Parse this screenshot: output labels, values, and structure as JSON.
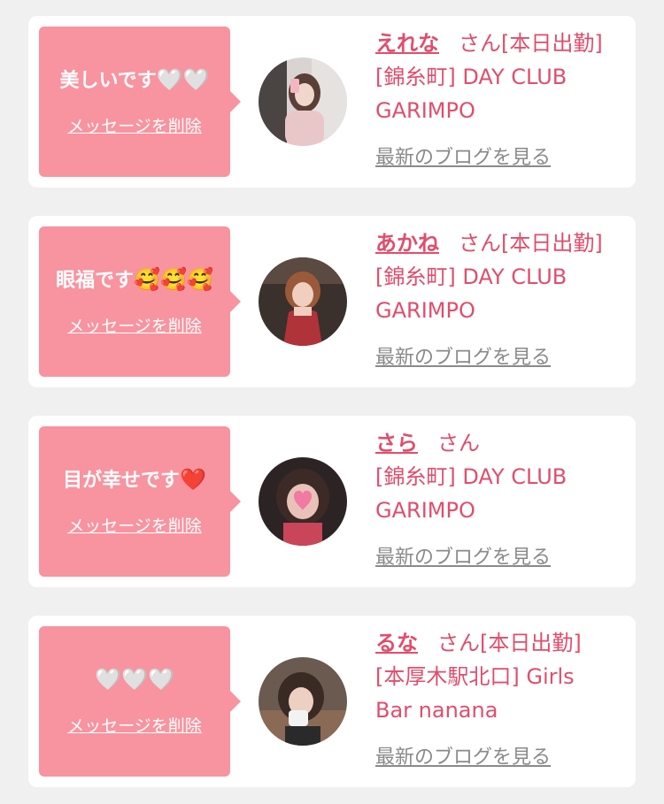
{
  "colors": {
    "background": "#f0f0f0",
    "card": "#ffffff",
    "bubble": "#f8949f",
    "accent": "#e04e6c",
    "link_gray": "#8a8a8a"
  },
  "delete_label": "メッセージを削除",
  "blog_label": "最新のブログを見る",
  "items": [
    {
      "message": "美しいです",
      "emoji": "🤍🤍",
      "emoji_icon": "white-heart-icon",
      "name": "えれな",
      "suffix": "さん[本日出勤]",
      "shop_line1": "[錦糸町] DAY CLUB",
      "shop_line2": "GARIMPO"
    },
    {
      "message": "眼福です",
      "emoji": "🥰🥰🥰",
      "emoji_icon": "smiling-face-with-hearts-icon",
      "name": "あかね",
      "suffix": "さん[本日出勤]",
      "shop_line1": "[錦糸町] DAY CLUB",
      "shop_line2": "GARIMPO"
    },
    {
      "message": "目が幸せです",
      "emoji": "❤️",
      "emoji_icon": "red-heart-icon",
      "name": "さら",
      "suffix": "さん",
      "shop_line1": "[錦糸町] DAY CLUB",
      "shop_line2": "GARIMPO"
    },
    {
      "message": "",
      "emoji": "🤍🤍🤍",
      "emoji_icon": "white-heart-icon",
      "name": "るな",
      "suffix": "さん[本日出勤]",
      "shop_line1": "[本厚木駅北口] Girls",
      "shop_line2": "Bar nanana"
    }
  ]
}
